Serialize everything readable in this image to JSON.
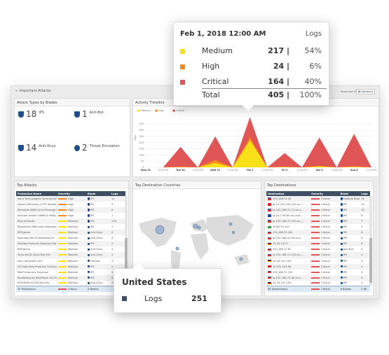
{
  "header": {
    "title": "Important Attacks",
    "resolution_mode": "Resolution Mode",
    "options": "Options"
  },
  "blades_panel": {
    "title": "Attack Types by Blades",
    "items": [
      {
        "count": "18",
        "label": "IPS",
        "icon": "ips-shield-icon"
      },
      {
        "count": "1",
        "label": "Anti-Bot",
        "icon": "anti-bot-icon"
      },
      {
        "count": "14",
        "label": "Anti-Virus",
        "icon": "anti-virus-icon"
      },
      {
        "count": "2",
        "label": "Threat Emulation",
        "icon": "threat-emulation-icon"
      }
    ]
  },
  "colors": {
    "medium": "#f9e11a",
    "high": "#f7891f",
    "critical": "#e05556",
    "logs": "#3e4f6b"
  },
  "chart_data": {
    "type": "area",
    "title": "Activity Timeline",
    "stacked": true,
    "ylabel": "Logs",
    "ylim": [
      0,
      350
    ],
    "yticks": [
      0,
      50,
      100,
      150,
      200,
      250,
      300,
      350
    ],
    "categories": [
      "Mon 29",
      "12:00 PM",
      "Tue 30",
      "12:00 PM",
      "Wed 31",
      "12:00 PM",
      "Thu 1",
      "12:00 PM",
      "Fri 2",
      "12:00 PM",
      "Sat 3",
      "12:00 PM",
      "Sun 4",
      "12:00 PM"
    ],
    "series": [
      {
        "name": "Medium",
        "values": [
          0,
          0,
          2,
          0,
          35,
          0,
          217,
          0,
          3,
          0,
          8,
          0,
          5,
          0
        ]
      },
      {
        "name": "High",
        "values": [
          0,
          0,
          3,
          0,
          25,
          0,
          24,
          0,
          2,
          0,
          4,
          0,
          3,
          0
        ]
      },
      {
        "name": "Critical",
        "values": [
          0,
          0,
          160,
          0,
          190,
          0,
          164,
          0,
          110,
          0,
          228,
          0,
          262,
          0
        ]
      }
    ],
    "legend": "top-left",
    "grid": true
  },
  "timeline_tooltip": {
    "date": "Feb 1, 2018 12:00 AM",
    "col": "Logs",
    "rows": [
      {
        "label": "Medium",
        "value": "217",
        "pct": "54%"
      },
      {
        "label": "High",
        "value": "24",
        "pct": "6%"
      },
      {
        "label": "Critical",
        "value": "164",
        "pct": "40%"
      }
    ],
    "total": {
      "label": "Total",
      "value": "405",
      "pct": "100%"
    }
  },
  "top_attacks": {
    "title": "Top Attacks",
    "columns": [
      "Protection Name",
      "Severity",
      "Blade",
      "Logs"
    ],
    "rows": [
      [
        "Avira Technologies SecurityGatew...",
        "High",
        "IPS",
        "10"
      ],
      [
        "Novell eDirectory HTTP Headers ...",
        "High",
        "IPS",
        "9"
      ],
      [
        "Microsoft WINS Local Privilege Esc...",
        "High",
        "IPS",
        "6"
      ],
      [
        "Multiple Vendor SNMPv3 HMAC H...",
        "High",
        "IPS",
        "1"
      ],
      [
        "Ping of Death",
        "Medium",
        "IPS",
        "178"
      ],
      [
        "Repetitive SMB Login Attempts",
        "Medium",
        "IPS",
        "7"
      ],
      [
        "REP.gecxo",
        "Medium",
        "Anti-Virus",
        "6"
      ],
      [
        "Backdoor.Win32.Bredolab.fcn",
        "Medium",
        "Anti-Virus",
        "4"
      ],
      [
        "Multiple Products Directory Serve...",
        "Medium",
        "IPS",
        "4"
      ],
      [
        "REP.gecxp",
        "Medium",
        "Anti-Virus",
        "4"
      ],
      [
        "Virus.Win32.Eicar.Test-File",
        "Medium",
        "Anti-Virus",
        "4"
      ],
      [
        "Non Compliant CIFS",
        "Medium",
        "Firewall",
        "3"
      ],
      [
        "HP OpenView Products OvTrace S...",
        "Medium",
        "IPS",
        "3"
      ],
      [
        "IMAP Directory Traversal",
        "Medium",
        "IPS",
        "3"
      ],
      [
        "RealNetworks RealPlayer AVI Pars...",
        "Medium",
        "IPS",
        "3"
      ],
      [
        "MODIFIED-EICAR-Test-File",
        "Medium",
        "Anti-Virus",
        "3"
      ]
    ],
    "footer": [
      "32 Protections",
      "Critical",
      "5 Blades",
      ""
    ]
  },
  "map": {
    "title": "Top Destination Countries",
    "tooltip": {
      "country": "United States",
      "label": "Logs",
      "value": "251"
    }
  },
  "top_destinations": {
    "title": "Top Destinations",
    "columns": [
      "Destination",
      "Severity",
      "Blade",
      "Logs"
    ],
    "rows": [
      [
        "US",
        "192.168.72.40",
        "Critical",
        "Multiple Blades",
        "10"
      ],
      [
        "CN",
        "ip-10-225-243-132.eu-...",
        "Critical",
        "IPS",
        "10"
      ],
      [
        "US",
        "ip-192-168-72-71.eu-c...",
        "Critical",
        "IPS",
        "10"
      ],
      [
        "AU",
        "ip-10-7-98-85.eu-cent...",
        "Critical",
        "IPS",
        "8"
      ],
      [
        "US",
        "ip-192-168-72-190.eu-...",
        "Critical",
        "IPS",
        "7"
      ],
      [
        "BR",
        "10.82.92.147",
        "Critical",
        "IPS",
        "6"
      ],
      [
        "US",
        "192.168.72.162",
        "Critical",
        "IPS",
        "6"
      ],
      [
        "US",
        "ip-192-168-20-92.eu-c...",
        "Critical",
        "IPS",
        "6"
      ],
      [
        "DE",
        "10.23.147.5",
        "Critical",
        "IPS",
        "6"
      ],
      [
        "US",
        "192.168.72.87",
        "Critical",
        "Anti-Bot",
        "4"
      ],
      [
        "US",
        "ip-192-168-11-122.eu-...",
        "Critical",
        "IPS",
        "4"
      ],
      [
        "DE",
        "10.23.147.132",
        "Critical",
        "IPS",
        "4"
      ],
      [
        "CN",
        "10.225.243.64",
        "Critical",
        "IPS",
        "4"
      ],
      [
        "US",
        "192.168.72.129",
        "Critical",
        "IPS",
        "4"
      ],
      [
        "US",
        "ip-192-168-72-80.eu-c...",
        "Critical",
        "IPS",
        "4"
      ],
      [
        "DE",
        "10.23.147.159",
        "Critical",
        "IPS",
        "4"
      ]
    ],
    "footer": [
      "96 Destinations",
      "Critical",
      "6 Blades",
      "1.9K"
    ]
  }
}
